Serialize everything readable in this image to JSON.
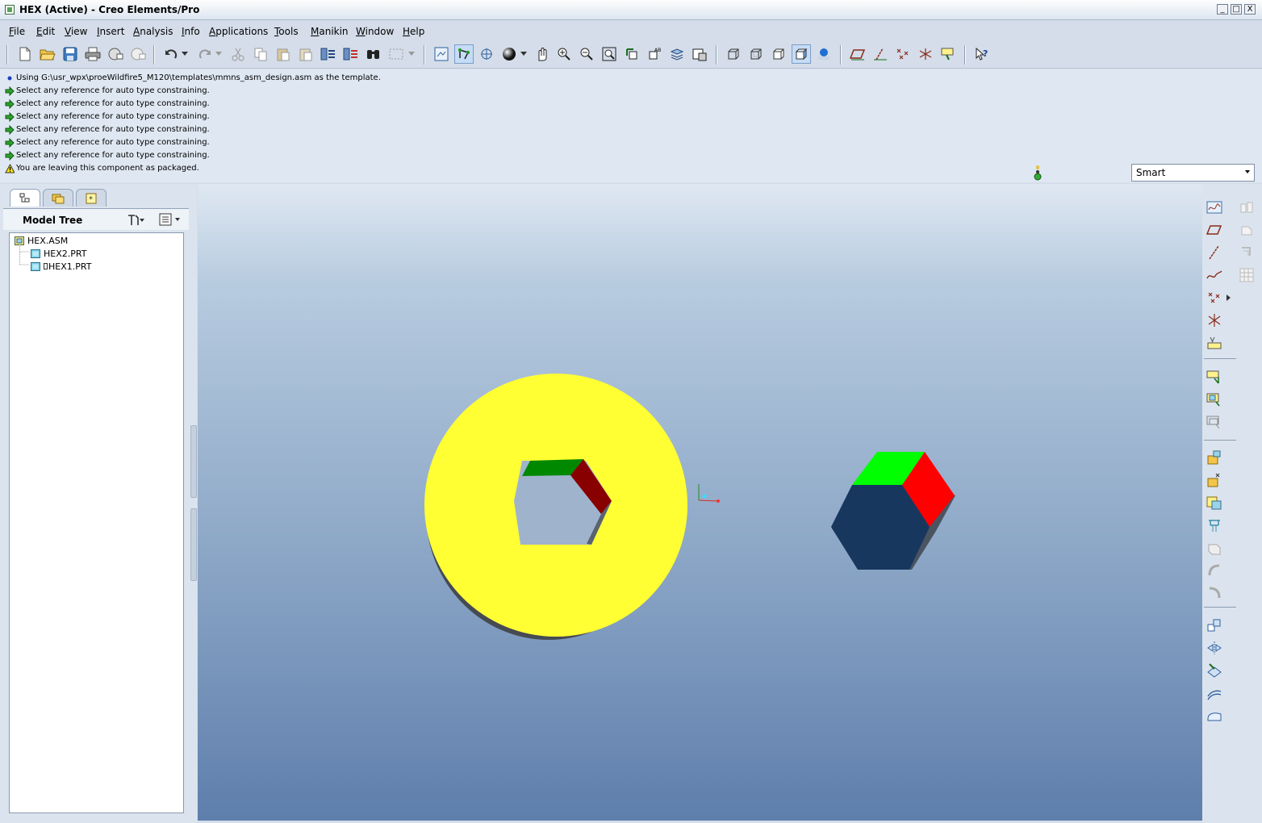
{
  "window": {
    "title": "HEX (Active) - Creo Elements/Pro",
    "controls": [
      "_",
      "□",
      "X"
    ]
  },
  "menu": [
    {
      "label": "File"
    },
    {
      "label": "Edit"
    },
    {
      "label": "View"
    },
    {
      "label": "Insert"
    },
    {
      "label": "Analysis"
    },
    {
      "label": "Info"
    },
    {
      "label": "Applications"
    },
    {
      "label": "Tools"
    },
    {
      "label": "Manikin"
    },
    {
      "label": "Window"
    },
    {
      "label": "Help"
    }
  ],
  "messages": [
    {
      "type": "info",
      "text": "Using G:\\usr_wpx\\proeWildfire5_M120\\templates\\mmns_asm_design.asm as the template."
    },
    {
      "type": "prompt",
      "text": "Select any reference for auto type constraining."
    },
    {
      "type": "prompt",
      "text": "Select any reference for auto type constraining."
    },
    {
      "type": "prompt",
      "text": "Select any reference for auto type constraining."
    },
    {
      "type": "prompt",
      "text": "Select any reference for auto type constraining."
    },
    {
      "type": "prompt",
      "text": "Select any reference for auto type constraining."
    },
    {
      "type": "prompt",
      "text": "Select any reference for auto type constraining."
    },
    {
      "type": "warning",
      "text": "You are leaving this component as packaged."
    }
  ],
  "filter": {
    "value": "Smart"
  },
  "model_tree": {
    "title": "Model Tree",
    "items": [
      {
        "label": "HEX.ASM"
      },
      {
        "label": "HEX2.PRT"
      },
      {
        "label": "HEX1.PRT"
      }
    ]
  },
  "colors": {
    "washer_face": "#ffff33",
    "washer_side": "#464a52",
    "hex_top": "#00ff00",
    "hex_right": "#ff0000",
    "hex_front": "#17375e",
    "hole_green": "#008800",
    "hole_red": "#880000",
    "viewport_top": "#dfe8f2",
    "viewport_bottom": "#5e7eac"
  }
}
